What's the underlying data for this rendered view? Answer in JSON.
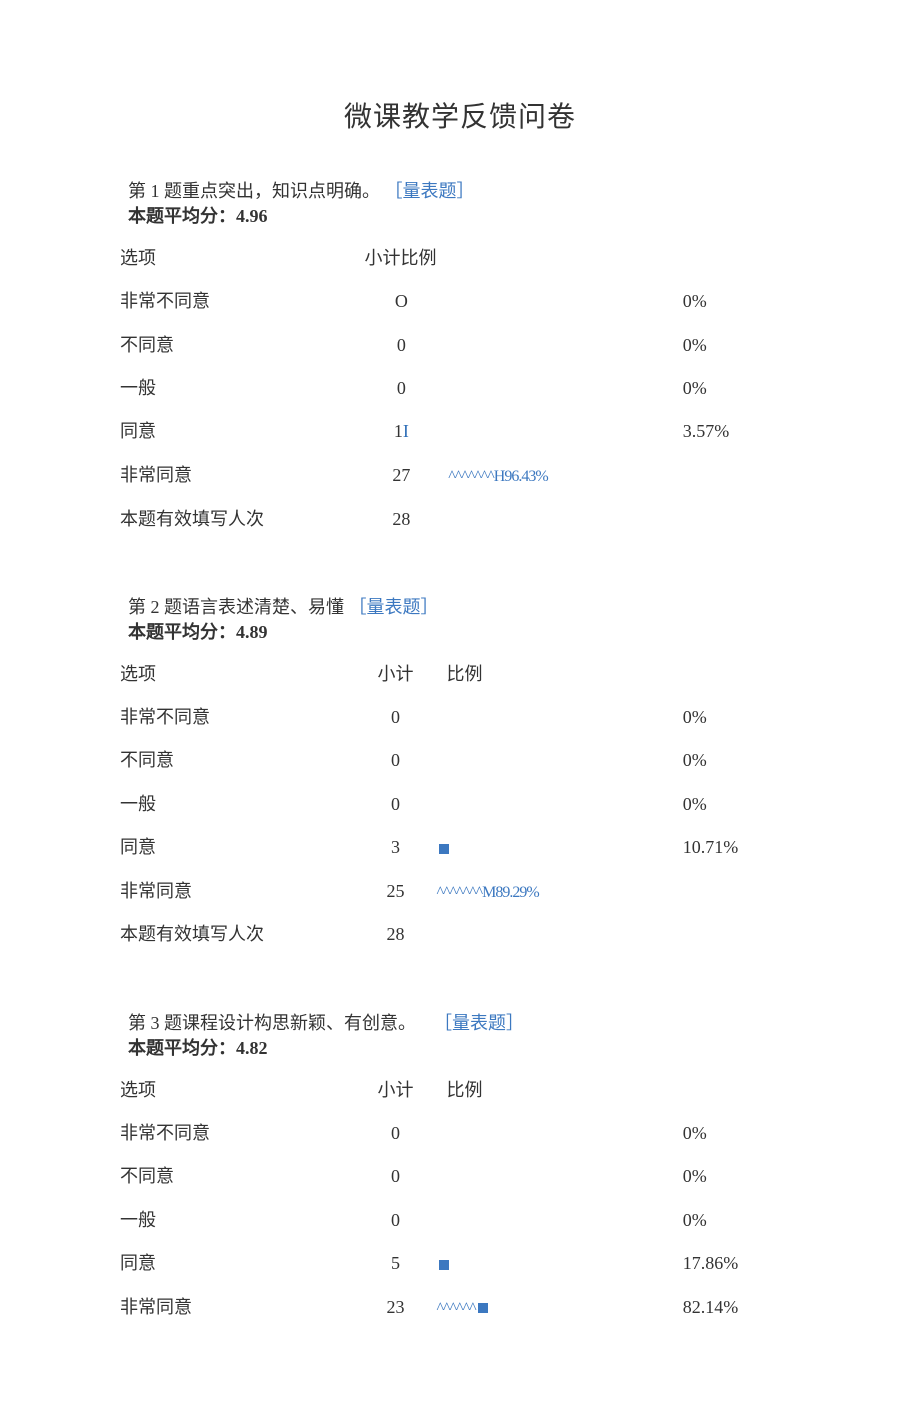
{
  "title": "微课教学反馈问卷",
  "headers": {
    "option": "选项",
    "count": "小计",
    "ratio": "比例"
  },
  "avg_label_prefix": "本题平均分：",
  "valid_label": "本题有效填写人次",
  "tag": "［量表题］",
  "questions": [
    {
      "num_label": "第 1 题",
      "text": "重点突出，知识点明确。",
      "avg": "4.96",
      "count_header_merged": "小计比例",
      "valid": "28",
      "rows": [
        {
          "opt": "非常不同意",
          "count": "O",
          "bar": "",
          "pct": "0%"
        },
        {
          "opt": "不同意",
          "count": "0",
          "bar": "",
          "pct": "0%"
        },
        {
          "opt": "一般",
          "count": "0",
          "bar": "",
          "pct": "0%"
        },
        {
          "opt": "同意",
          "count": "1",
          "count_suffix": "I",
          "bar": "",
          "pct": "3.57%"
        },
        {
          "opt": "非常同意",
          "count": "27",
          "bar": "^^^^^^^H96.43%",
          "pct": ""
        }
      ]
    },
    {
      "num_label": "第 2 题",
      "text": "语言表述清楚、易懂",
      "avg": "4.89",
      "valid": "28",
      "rows": [
        {
          "opt": "非常不同意",
          "count": "0",
          "bar": "",
          "pct": "0%"
        },
        {
          "opt": "不同意",
          "count": "0",
          "bar": "",
          "pct": "0%"
        },
        {
          "opt": "一般",
          "count": "0",
          "bar": "",
          "pct": "0%"
        },
        {
          "opt": "同意",
          "count": "3",
          "bar": "",
          "sq": true,
          "pct": "10.71%"
        },
        {
          "opt": "非常同意",
          "count": "25",
          "bar": "^^^^^^^M89.29%",
          "pct": ""
        }
      ]
    },
    {
      "num_label": "第 3 题",
      "text": "课程设计构思新颖、有创意。",
      "avg": "4.82",
      "rows": [
        {
          "opt": "非常不同意",
          "count": "0",
          "bar": "",
          "pct": "0%"
        },
        {
          "opt": "不同意",
          "count": "0",
          "bar": "",
          "pct": "0%"
        },
        {
          "opt": "一般",
          "count": "0",
          "bar": "",
          "pct": "0%"
        },
        {
          "opt": "同意",
          "count": "5",
          "bar": "",
          "sq": true,
          "pct": "17.86%"
        },
        {
          "opt": "非常同意",
          "count": "23",
          "bar": "^^^^^^",
          "sq": true,
          "pct": "82.14%"
        }
      ]
    }
  ],
  "chart_data": [
    {
      "type": "table",
      "title": "第1题 重点突出，知识点明确。",
      "avg": 4.96,
      "categories": [
        "非常不同意",
        "不同意",
        "一般",
        "同意",
        "非常同意"
      ],
      "counts": [
        0,
        0,
        0,
        1,
        27
      ],
      "percents": [
        0,
        0,
        0,
        3.57,
        96.43
      ],
      "n": 28
    },
    {
      "type": "table",
      "title": "第2题 语言表述清楚、易懂",
      "avg": 4.89,
      "categories": [
        "非常不同意",
        "不同意",
        "一般",
        "同意",
        "非常同意"
      ],
      "counts": [
        0,
        0,
        0,
        3,
        25
      ],
      "percents": [
        0,
        0,
        0,
        10.71,
        89.29
      ],
      "n": 28
    },
    {
      "type": "table",
      "title": "第3题 课程设计构思新颖、有创意。",
      "avg": 4.82,
      "categories": [
        "非常不同意",
        "不同意",
        "一般",
        "同意",
        "非常同意"
      ],
      "counts": [
        0,
        0,
        0,
        5,
        23
      ],
      "percents": [
        0,
        0,
        0,
        17.86,
        82.14
      ]
    }
  ]
}
